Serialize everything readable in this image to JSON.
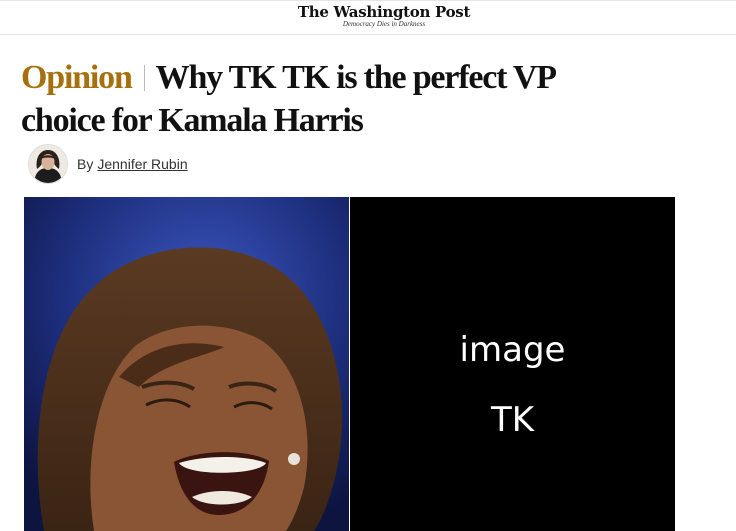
{
  "masthead": {
    "logo": "The Washington Post",
    "tagline": "Democracy Dies in Darkness"
  },
  "article": {
    "section": "Opinion",
    "title": "Why TK TK is the perfect VP choice for Kamala Harris",
    "byline_prefix": "By",
    "author": "Jennifer Rubin"
  },
  "images": {
    "left_photo_subject": "Kamala Harris smiling",
    "placeholder_line1": "image",
    "placeholder_line2": "TK"
  },
  "colors": {
    "kicker": "#a6700f",
    "placeholder_bg": "#000000"
  }
}
